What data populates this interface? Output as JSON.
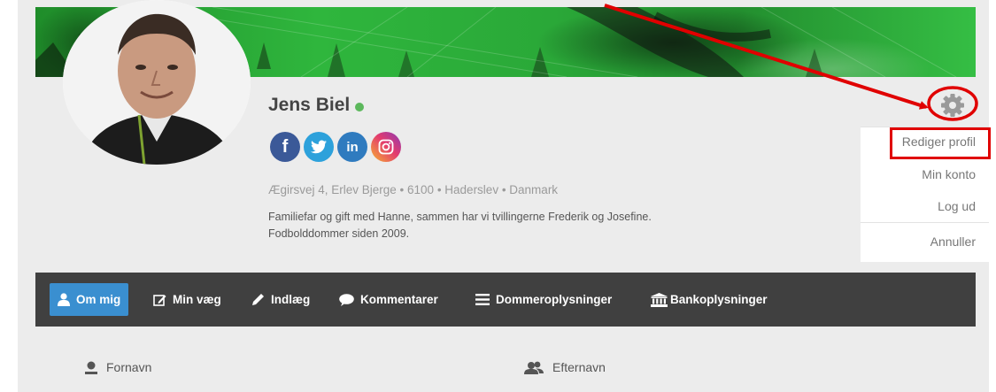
{
  "profile": {
    "name": "Jens Biel",
    "address": "Ægirsvej 4, Erlev Bjerge  •  6100  •  Haderslev  •  Danmark",
    "bio_line1": "Familiefar og gift med Hanne, sammen har vi tvillingerne Frederik og Josefine.",
    "bio_line2": "Fodbolddommer siden 2009.",
    "online_color": "#5cb85c"
  },
  "socials": [
    {
      "icon": "facebook-icon",
      "label": "f"
    },
    {
      "icon": "twitter-icon",
      "label": ""
    },
    {
      "icon": "linkedin-icon",
      "label": "in"
    },
    {
      "icon": "instagram-icon",
      "label": ""
    }
  ],
  "menu": {
    "items": [
      {
        "label": "Rediger profil"
      },
      {
        "label": "Min konto"
      },
      {
        "label": "Log ud"
      },
      {
        "label": "Annuller"
      }
    ]
  },
  "nav": {
    "items": [
      {
        "label": "Om mig",
        "icon": "user-icon",
        "active": true
      },
      {
        "label": "Min væg",
        "icon": "edit-icon"
      },
      {
        "label": "Indlæg",
        "icon": "pencil-icon"
      },
      {
        "label": "Kommentarer",
        "icon": "comment-icon"
      },
      {
        "label": "Dommeroplysninger",
        "icon": "list-icon"
      },
      {
        "label": "Bankoplysninger",
        "icon": "bank-icon"
      }
    ],
    "active_color": "#3a8fd0",
    "bar_color": "#404040"
  },
  "fields": {
    "first_name_label": "Fornavn",
    "last_name_label": "Efternavn"
  },
  "annotation_color": "#e00000"
}
